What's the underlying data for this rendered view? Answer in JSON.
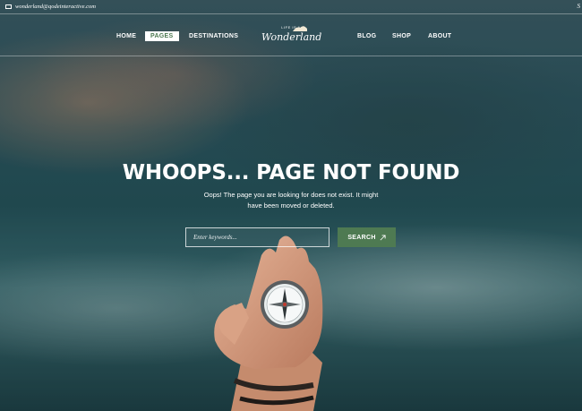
{
  "topbar": {
    "email": "wonderland@qodeinteractive.com",
    "search_letter": "S"
  },
  "nav": {
    "items": [
      {
        "label": "HOME"
      },
      {
        "label": "PAGES"
      },
      {
        "label": "DESTINATIONS"
      },
      {
        "label": "BLOG"
      },
      {
        "label": "SHOP"
      },
      {
        "label": "ABOUT"
      }
    ],
    "active_index": 1,
    "logo": {
      "small_text": "LIFE IS A",
      "script_text": "Wonderland"
    }
  },
  "hero": {
    "heading": "WHOOPS... PAGE NOT FOUND",
    "subtext": "Oops! The page you are looking for does not exist. It might have been moved or deleted.",
    "search_placeholder": "Enter keywords...",
    "search_button": "SEARCH",
    "search_button_icon": "arrow-up-right-icon"
  },
  "colors": {
    "accent": "#4e7a52",
    "text": "#ffffff"
  }
}
